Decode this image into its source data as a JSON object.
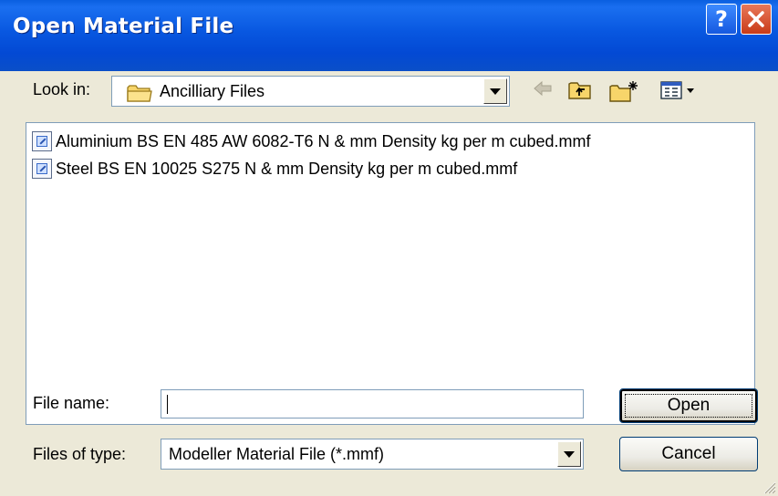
{
  "window": {
    "title": "Open Material File",
    "help_label": "?",
    "close_label": "✕"
  },
  "look_in": {
    "label": "Look in:",
    "value": "Ancilliary Files"
  },
  "toolbar": {
    "icons": [
      "back-arrow-icon",
      "up-folder-icon",
      "new-folder-icon",
      "view-menu-icon"
    ]
  },
  "files": [
    {
      "name": "Aluminium BS EN 485 AW 6082-T6 N & mm Density kg per m cubed.mmf",
      "icon": "material-file-icon"
    },
    {
      "name": "Steel BS EN 10025 S275 N & mm Density kg per m cubed.mmf",
      "icon": "material-file-icon"
    }
  ],
  "file_name": {
    "label": "File name:",
    "value": ""
  },
  "file_type": {
    "label": "Files of type:",
    "value": "Modeller Material File (*.mmf)"
  },
  "buttons": {
    "open": "Open",
    "cancel": "Cancel"
  },
  "colors": {
    "titlebar": "#0a5fe0",
    "dialog_bg": "#ece9d8",
    "field_border": "#7f9db9",
    "close_button": "#c93b18"
  }
}
